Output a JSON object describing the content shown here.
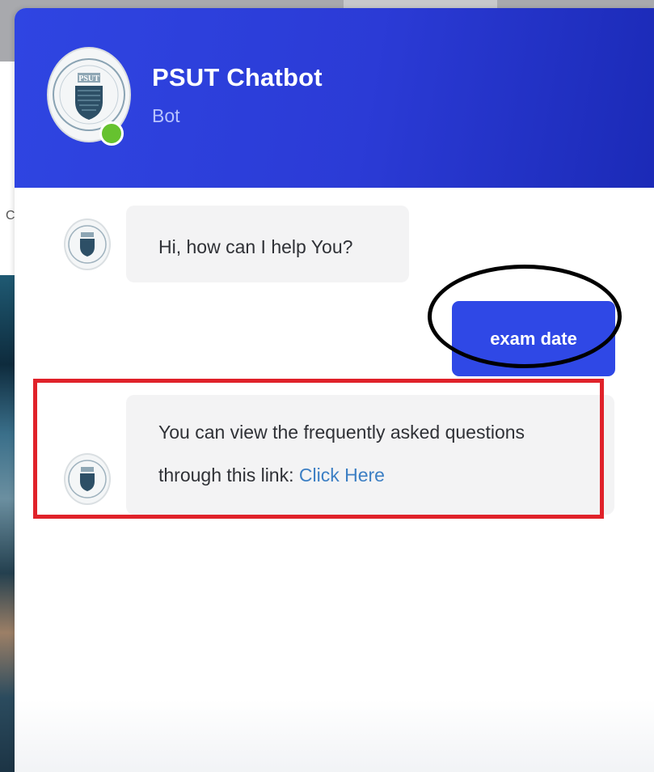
{
  "header": {
    "title": "PSUT Chatbot",
    "subtitle": "Bot",
    "avatar_icon": "psut-logo-icon",
    "status_color": "#66c22f"
  },
  "background": {
    "left_text": "C"
  },
  "messages": [
    {
      "sender": "bot",
      "text": "Hi, how can I help You?"
    },
    {
      "sender": "user",
      "text": "exam date"
    },
    {
      "sender": "bot",
      "text_line1": "You can view the frequently asked questions",
      "text_line2_prefix": "through this link: ",
      "link_text": "Click Here"
    }
  ],
  "colors": {
    "header_accent": "#2f45e2",
    "user_bubble": "#2f48e6",
    "link": "#3c7fc4",
    "annotation_rect": "#e0222a",
    "annotation_ellipse": "#000000"
  }
}
